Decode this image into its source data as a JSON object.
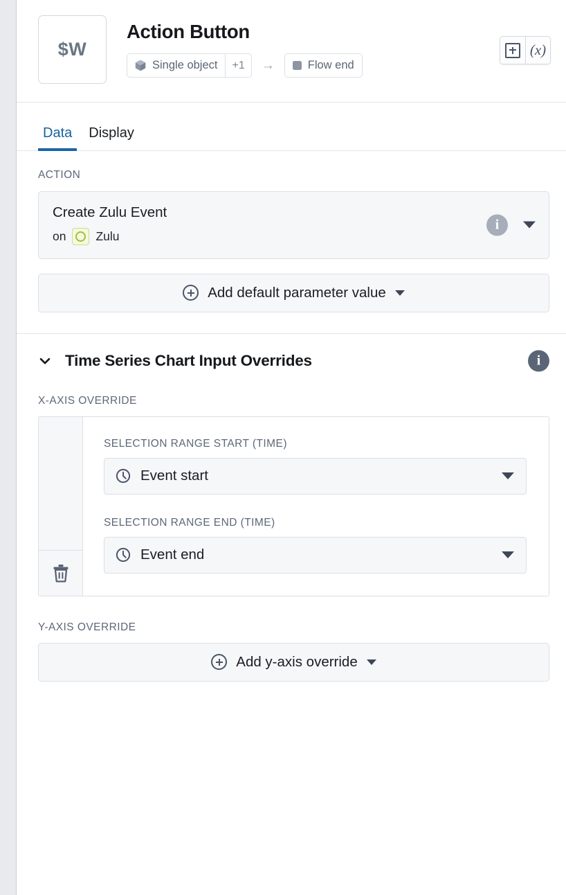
{
  "window": {
    "left_rail_color": "#e8eaed",
    "accent_color": "#1a66a8"
  },
  "header": {
    "thumbnail_label": "$W",
    "title": "Action Button",
    "input_chip": {
      "icon": "cube-icon",
      "label": "Single object",
      "count_badge": "+1"
    },
    "arrow": "→",
    "output_chip": {
      "icon": "square-icon",
      "label": "Flow end"
    },
    "actions": [
      {
        "name": "add-boxed-plus-button",
        "icon": "boxed-plus-icon",
        "label": "+"
      },
      {
        "name": "variable-expression-button",
        "icon": "fx-icon",
        "label": "(x)"
      }
    ]
  },
  "tabs": [
    {
      "label": "Data",
      "active": true
    },
    {
      "label": "Display",
      "active": false
    }
  ],
  "action_section": {
    "caption": "ACTION",
    "card": {
      "title": "Create Zulu Event",
      "on_prefix": "on",
      "object_name": "Zulu",
      "object_icon_color": "#9bc72b",
      "info_icon": "info-icon",
      "dropdown_icon": "caret-down-icon"
    },
    "add_default_parameter": {
      "label": "Add default parameter value",
      "icon": "plus-circle-icon",
      "caret": "caret-down-icon"
    }
  },
  "overrides_section": {
    "title": "Time Series Chart Input Overrides",
    "collapsed": false,
    "chevron_icon": "chevron-down-icon",
    "info_icon": "info-icon",
    "x_axis": {
      "caption": "X-AXIS OVERRIDE",
      "delete_icon": "trash-icon",
      "fields": [
        {
          "label": "SELECTION RANGE START (TIME)",
          "value": "Event start",
          "icon": "clock-icon"
        },
        {
          "label": "SELECTION RANGE END (TIME)",
          "value": "Event end",
          "icon": "clock-icon"
        }
      ]
    },
    "y_axis": {
      "caption": "Y-AXIS OVERRIDE",
      "add_button": {
        "label": "Add y-axis override",
        "icon": "plus-circle-icon",
        "caret": "caret-down-icon"
      }
    }
  }
}
